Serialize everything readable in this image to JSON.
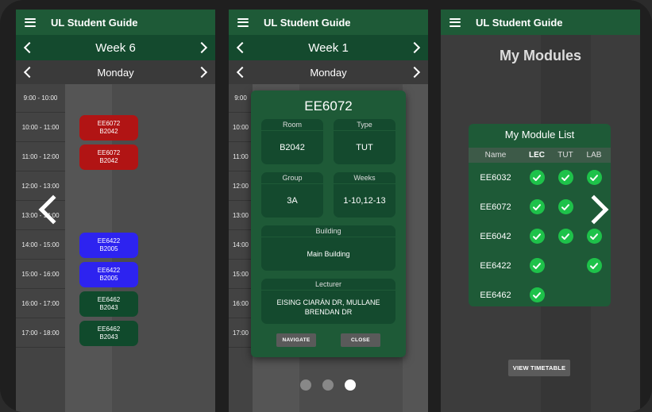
{
  "screen1": {
    "app_title": "UL Student Guide",
    "week": "Week 6",
    "day": "Monday",
    "time_slots": [
      "9:00 - 10:00",
      "10:00 - 11:00",
      "11:00 - 12:00",
      "12:00 - 13:00",
      "13:00 - 14:00",
      "14:00 - 15:00",
      "15:00 - 16:00",
      "16:00 - 17:00",
      "17:00 - 18:00"
    ],
    "events": [
      {
        "module": "EE6072",
        "room": "B2042",
        "color": "#b11414"
      },
      {
        "module": "EE6072",
        "room": "B2042",
        "color": "#b11414"
      },
      {
        "module": "EE6422",
        "room": "B2005",
        "color": "#2d23f0"
      },
      {
        "module": "EE6422",
        "room": "B2005",
        "color": "#2d23f0"
      },
      {
        "module": "EE6462",
        "room": "B2043",
        "color": "#104a2c"
      },
      {
        "module": "EE6462",
        "room": "B2043",
        "color": "#104a2c"
      }
    ]
  },
  "screen2": {
    "app_title": "UL Student Guide",
    "week": "Week 1",
    "day": "Monday",
    "time_slots": [
      "9:00",
      "10:00",
      "11:00",
      "12:00",
      "13:00",
      "14:00",
      "15:00",
      "16:00",
      "17:00"
    ],
    "dialog": {
      "title": "EE6072",
      "room_label": "Room",
      "room": "B2042",
      "type_label": "Type",
      "type": "TUT",
      "group_label": "Group",
      "group": "3A",
      "weeks_label": "Weeks",
      "weeks": "1-10,12-13",
      "building_label": "Building",
      "building": "Main Building",
      "lecturer_label": "Lecturer",
      "lecturer": "EISING CIARÁN DR, MULLANE BRENDAN DR",
      "navigate_label": "NAVIGATE",
      "close_label": "CLOSE"
    },
    "pager_dots": 3,
    "active_dot": 3
  },
  "screen3": {
    "app_title": "UL Student Guide",
    "page_title": "My Modules",
    "card_title": "My Module List",
    "columns": [
      "Name",
      "LEC",
      "TUT",
      "LAB"
    ],
    "modules": [
      {
        "name": "EE6032",
        "lec": true,
        "tut": true,
        "lab": true
      },
      {
        "name": "EE6072",
        "lec": true,
        "tut": true,
        "lab": false
      },
      {
        "name": "EE6042",
        "lec": true,
        "tut": true,
        "lab": true
      },
      {
        "name": "EE6422",
        "lec": true,
        "tut": false,
        "lab": true
      },
      {
        "name": "EE6462",
        "lec": true,
        "tut": false,
        "lab": false
      }
    ],
    "view_button": "VIEW TIMETABLE"
  },
  "icons": {
    "menu": "hamburger-icon",
    "prev": "chevron-left-icon",
    "next": "chevron-right-icon",
    "check": "check-circle-icon"
  },
  "colors": {
    "brand_green": "#1e5a37",
    "dark_green": "#144a2e",
    "check_green": "#1ec24a"
  }
}
